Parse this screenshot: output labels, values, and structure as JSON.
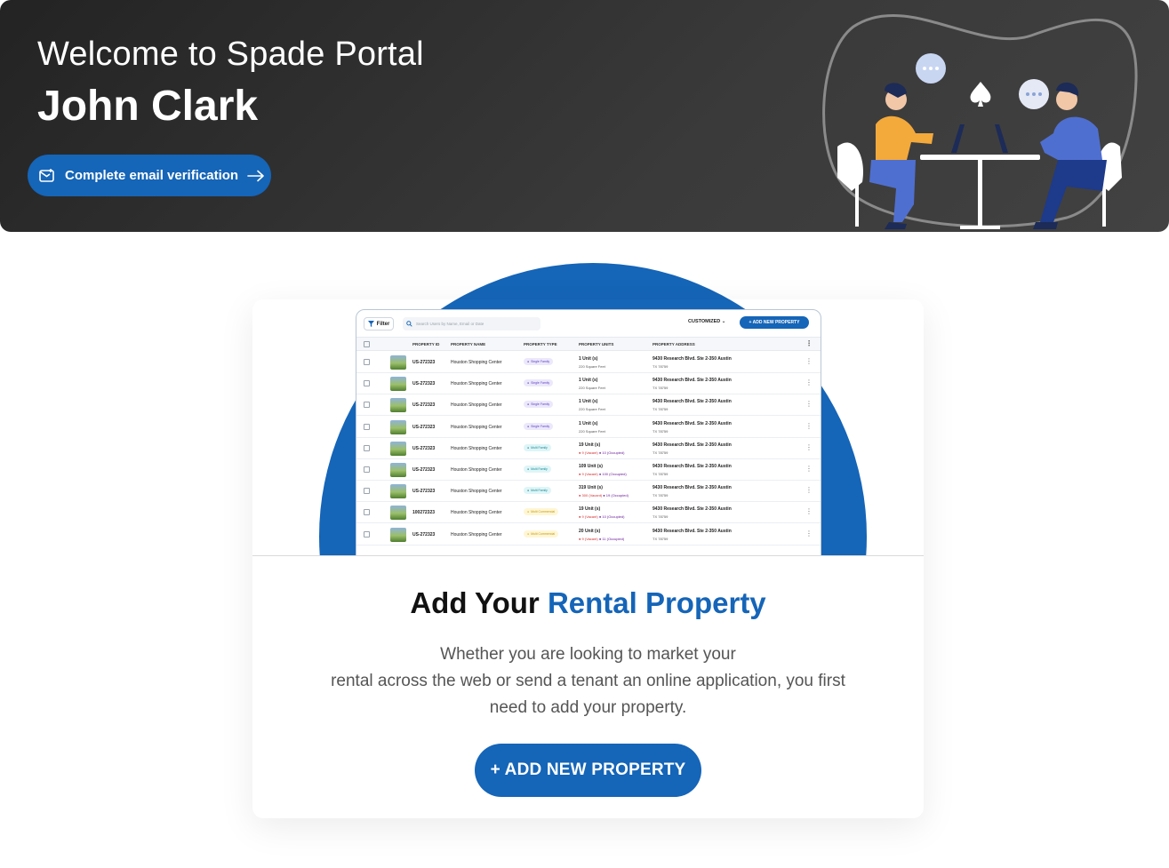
{
  "hero": {
    "welcome": "Welcome to Spade Portal",
    "user_name": "John Clark",
    "verify_label": "Complete email verification"
  },
  "mini_table": {
    "filter_label": "Filter",
    "search_placeholder": "Search Users by Name, Email or Date",
    "view_label": "CUSTOMIZED",
    "add_label": "+ ADD NEW PROPERTY",
    "headers": [
      "PROPERTY ID",
      "PROPERTY NAME",
      "PROPERTY TYPE",
      "PROPERTY UNITS",
      "PROPERTY ADDRESS"
    ],
    "rows": [
      {
        "id": "US-272323",
        "name": "Houston Shopping Center",
        "type": "Single Family",
        "units": "1 Unit (s)",
        "sub": "220 Square Feet",
        "addr": "9430 Research Blvd. Ste 2-350 Austin",
        "addr2": "TX 78759"
      },
      {
        "id": "US-272323",
        "name": "Houston Shopping Center",
        "type": "Single Family",
        "units": "1 Unit (s)",
        "sub": "220 Square Feet",
        "addr": "9430 Research Blvd. Ste 2-350 Austin",
        "addr2": "TX 78759"
      },
      {
        "id": "US-272323",
        "name": "Houston Shopping Center",
        "type": "Single Family",
        "units": "1 Unit (s)",
        "sub": "220 Square Feet",
        "addr": "9430 Research Blvd. Ste 2-350 Austin",
        "addr2": "TX 78759"
      },
      {
        "id": "US-272323",
        "name": "Houston Shopping Center",
        "type": "Single Family",
        "units": "1 Unit (s)",
        "sub": "220 Square Feet",
        "addr": "9430 Research Blvd. Ste 2-350 Austin",
        "addr2": "TX 78759"
      },
      {
        "id": "US-272323",
        "name": "Houston Shopping Center",
        "type": "Multi Family",
        "units": "19 Unit (s)",
        "vacant": "9 (Vacant)",
        "occupied": "10 (Occupied)",
        "addr": "9430 Research Blvd. Ste 2-350 Austin",
        "addr2": "TX 78759"
      },
      {
        "id": "US-272323",
        "name": "Houston Shopping Center",
        "type": "Multi Family",
        "units": "109 Unit (s)",
        "vacant": "9 (Vacant)",
        "occupied": "100 (Occupied)",
        "addr": "9430 Research Blvd. Ste 2-350 Austin",
        "addr2": "TX 78759"
      },
      {
        "id": "US-272323",
        "name": "Houston Shopping Center",
        "type": "Multi Family",
        "units": "319 Unit (s)",
        "vacant": "300 (Vacant)",
        "occupied": "19 (Occupied)",
        "addr": "9430 Research Blvd. Ste 2-350 Austin",
        "addr2": "TX 78759"
      },
      {
        "id": "100272323",
        "name": "Houston Shopping Center",
        "type": "Multi Commercial",
        "units": "19 Unit (s)",
        "vacant": "9 (Vacant)",
        "occupied": "10 (Occupied)",
        "addr": "9430 Research Blvd. Ste 2-350 Austin",
        "addr2": "TX 78759"
      },
      {
        "id": "US-272323",
        "name": "Houston Shopping Center",
        "type": "Multi Commercial",
        "units": "20 Unit (s)",
        "vacant": "9 (Vacant)",
        "occupied": "11 (Occupied)",
        "addr": "9430 Research Blvd. Ste 2-350 Austin",
        "addr2": "TX 78759"
      }
    ]
  },
  "card": {
    "title_plain": "Add Your ",
    "title_accent": "Rental Property",
    "desc_line1": "Whether you are looking to market your",
    "desc_line2": "rental across the web or send a tenant an online application, you first",
    "desc_line3": "need to add your property.",
    "button_label": "+ ADD NEW PROPERTY"
  },
  "colors": {
    "accent": "#1565b8",
    "hero_bg": "#2e2e2e"
  }
}
